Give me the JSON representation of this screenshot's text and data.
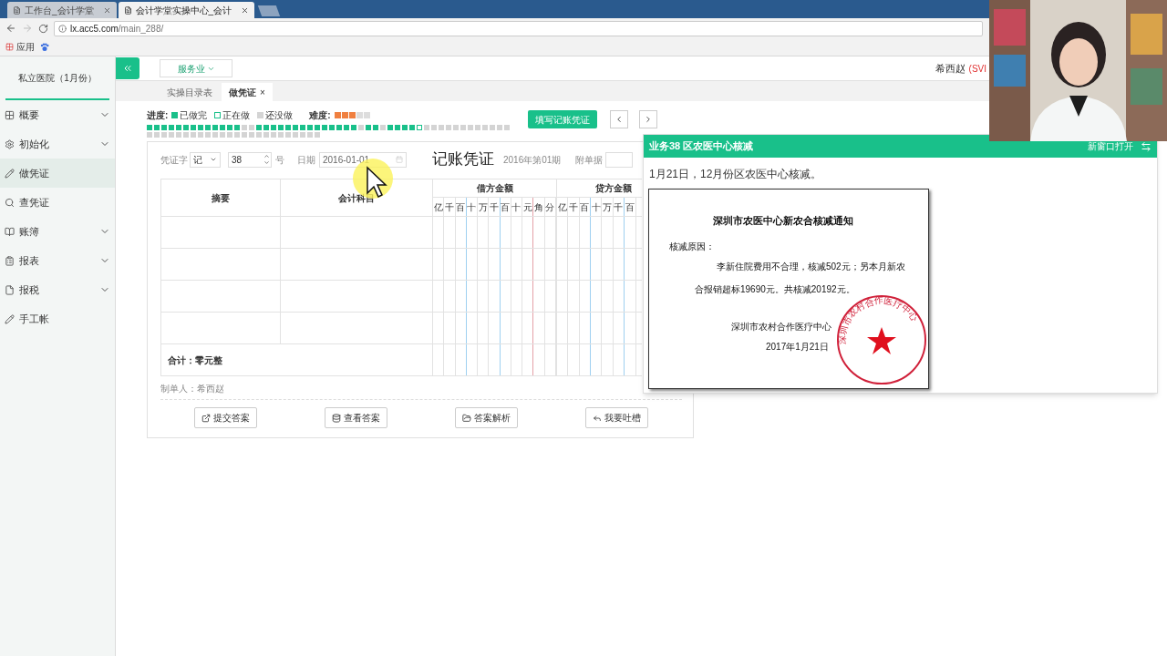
{
  "browser": {
    "tabs": [
      {
        "title": "工作台_会计学堂",
        "selected": false
      },
      {
        "title": "会计学堂实操中心_会计",
        "selected": true
      }
    ],
    "url_host": "lx.acc5.com",
    "url_path": "/main_288/",
    "bookmarks": [
      "应用"
    ]
  },
  "sidebar": {
    "company": "私立医院（1月份）",
    "items": [
      {
        "label": "概要",
        "expandable": true,
        "selected": false
      },
      {
        "label": "初始化",
        "expandable": true,
        "selected": false
      },
      {
        "label": "做凭证",
        "expandable": false,
        "selected": true
      },
      {
        "label": "查凭证",
        "expandable": false,
        "selected": false
      },
      {
        "label": "账簿",
        "expandable": true,
        "selected": false
      },
      {
        "label": "报表",
        "expandable": true,
        "selected": false
      },
      {
        "label": "报税",
        "expandable": true,
        "selected": false
      },
      {
        "label": "手工帐",
        "expandable": false,
        "selected": false
      }
    ]
  },
  "header": {
    "industry": "服务业",
    "user": "希西赵",
    "user_role": "(SVI"
  },
  "tabs": [
    {
      "label": "实操目录表",
      "selected": false
    },
    {
      "label": "做凭证",
      "selected": true,
      "close": "×"
    }
  ],
  "progress": {
    "label": "进度:",
    "legend": [
      {
        "kind": "done",
        "label": "已做完"
      },
      {
        "kind": "current",
        "label": "正在做"
      },
      {
        "kind": "todo",
        "label": "还没做"
      }
    ],
    "difficulty_label": "难度:",
    "stars": 3,
    "cells": [
      {
        "kind": "done"
      },
      {
        "kind": "done"
      },
      {
        "kind": "done"
      },
      {
        "kind": "done"
      },
      {
        "kind": "done"
      },
      {
        "kind": "done"
      },
      {
        "kind": "done"
      },
      {
        "kind": "done"
      },
      {
        "kind": "done"
      },
      {
        "kind": "done"
      },
      {
        "kind": "done"
      },
      {
        "kind": "done"
      },
      {
        "kind": "done"
      },
      {
        "kind": "todo"
      },
      {
        "kind": "todo"
      },
      {
        "kind": "done"
      },
      {
        "kind": "done"
      },
      {
        "kind": "done"
      },
      {
        "kind": "done"
      },
      {
        "kind": "done"
      },
      {
        "kind": "done"
      },
      {
        "kind": "done"
      },
      {
        "kind": "done"
      },
      {
        "kind": "done"
      },
      {
        "kind": "done"
      },
      {
        "kind": "done"
      },
      {
        "kind": "done"
      },
      {
        "kind": "done"
      },
      {
        "kind": "done"
      },
      {
        "kind": "todo"
      },
      {
        "kind": "done"
      },
      {
        "kind": "done"
      },
      {
        "kind": "todo"
      },
      {
        "kind": "done"
      },
      {
        "kind": "done"
      },
      {
        "kind": "done"
      },
      {
        "kind": "done"
      },
      {
        "kind": "current"
      },
      {
        "kind": "todo"
      },
      {
        "kind": "todo"
      },
      {
        "kind": "todo"
      },
      {
        "kind": "todo"
      },
      {
        "kind": "todo"
      },
      {
        "kind": "todo"
      },
      {
        "kind": "todo"
      },
      {
        "kind": "todo"
      },
      {
        "kind": "todo"
      },
      {
        "kind": "todo"
      },
      {
        "kind": "todo"
      },
      {
        "kind": "todo"
      },
      {
        "kind": "todo"
      },
      {
        "kind": "todo"
      },
      {
        "kind": "todo"
      },
      {
        "kind": "todo"
      },
      {
        "kind": "todo"
      },
      {
        "kind": "todo"
      },
      {
        "kind": "todo"
      },
      {
        "kind": "todo"
      },
      {
        "kind": "todo"
      },
      {
        "kind": "todo"
      },
      {
        "kind": "todo"
      },
      {
        "kind": "todo"
      },
      {
        "kind": "todo"
      },
      {
        "kind": "todo"
      },
      {
        "kind": "todo"
      },
      {
        "kind": "todo"
      },
      {
        "kind": "todo"
      },
      {
        "kind": "todo"
      },
      {
        "kind": "todo"
      },
      {
        "kind": "todo"
      },
      {
        "kind": "todo"
      },
      {
        "kind": "todo"
      },
      {
        "kind": "todo"
      },
      {
        "kind": "todo"
      }
    ]
  },
  "fill_button": "填写记账凭证",
  "voucher": {
    "type_label": "凭证字",
    "type_value": "记",
    "number": "38",
    "number_suffix": "号",
    "date_label": "日期",
    "date": "2016-01-01",
    "title": "记账凭证",
    "period": "2016年第01期",
    "attachments_label": "附单据",
    "columns": {
      "summary": "摘要",
      "account": "会计科目",
      "debit": "借方金额",
      "credit": "贷方金额"
    },
    "debit_digits": [
      "亿",
      "千",
      "百",
      "十",
      "万",
      "千",
      "百",
      "十",
      "元",
      "角",
      "分"
    ],
    "credit_digits": [
      "亿",
      "千",
      "百",
      "十",
      "万",
      "千",
      "百"
    ],
    "total": "合计：零元整",
    "maker": "制单人：希西赵",
    "actions": [
      {
        "label": "提交答案"
      },
      {
        "label": "查看答案"
      },
      {
        "label": "答案解析"
      },
      {
        "label": "我要吐槽"
      }
    ]
  },
  "popup": {
    "title": "业务38 区农医中心核减",
    "open_new": "新窗口打开",
    "description": "1月21日，12月份区农医中心核减。",
    "document": {
      "title": "深圳市农医中心新农合核减通知",
      "reason_label": "核减原因：",
      "reason": "李新住院费用不合理，核减502元；另本月新农合报销超标19690元。共核减20192元。",
      "issuer": "深圳市农村合作医疗中心",
      "date": "2017年1月21日",
      "stamp_text": "深圳市农村合作医疗中心"
    }
  }
}
